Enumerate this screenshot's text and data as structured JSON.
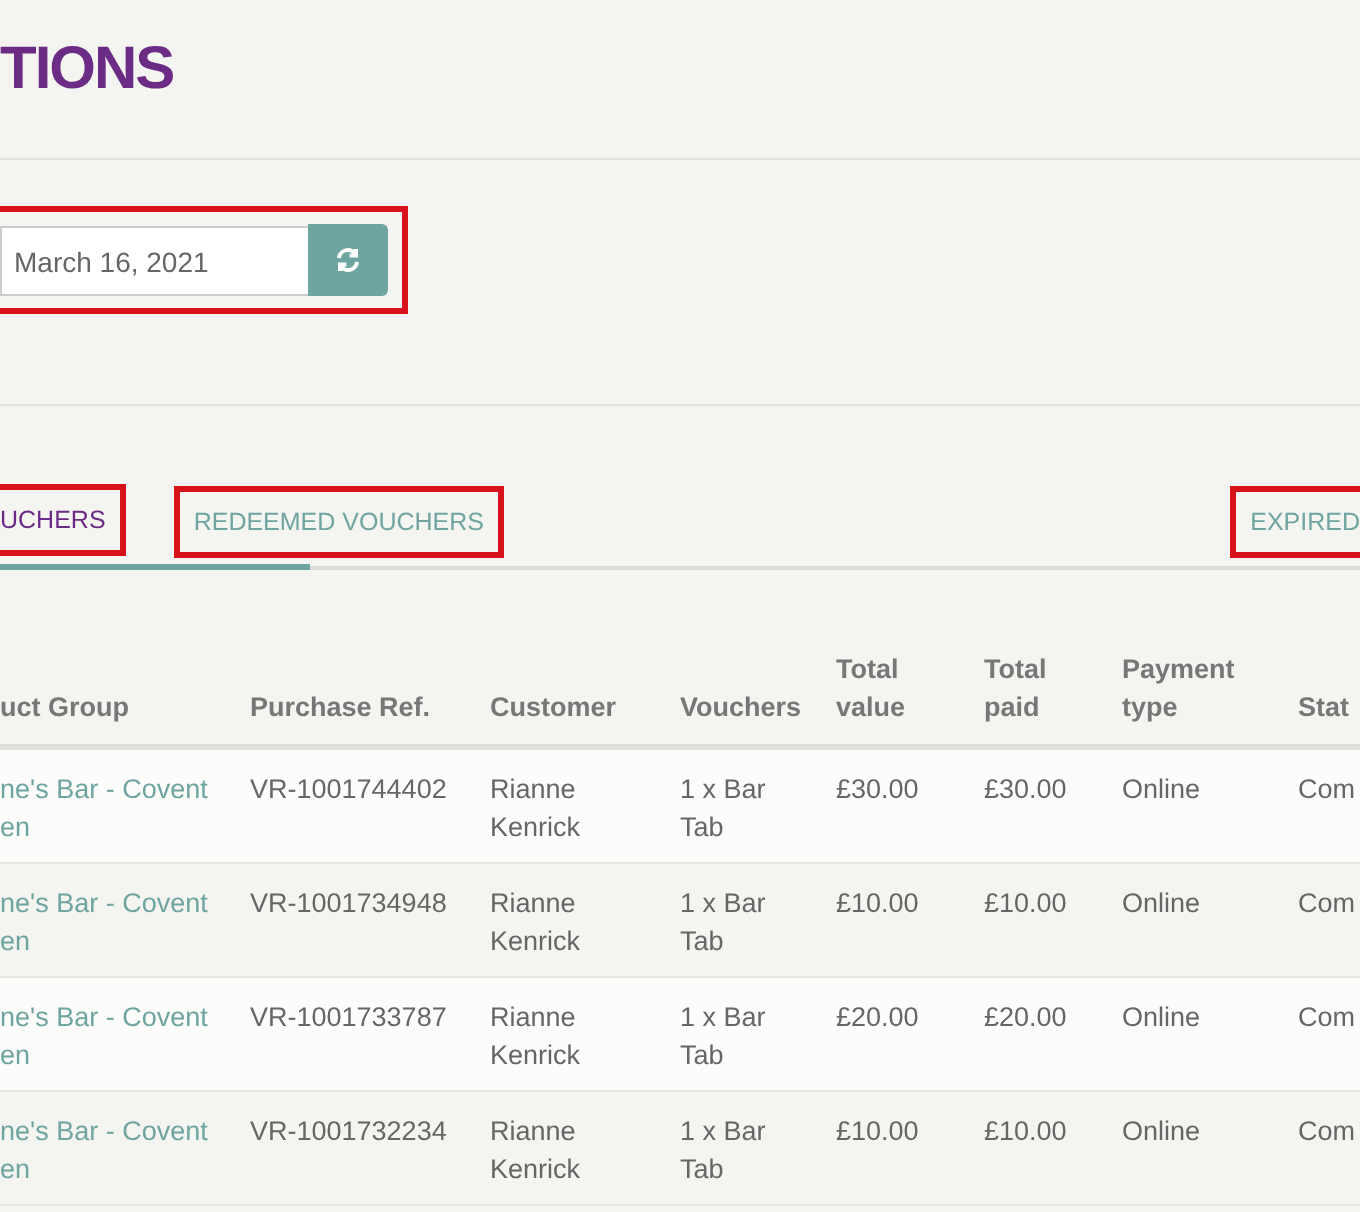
{
  "page_title": "TIONS",
  "date_filter": {
    "value": "March 16, 2021",
    "highlighted": true
  },
  "tabs": [
    {
      "label": "UCHERS",
      "selected": true,
      "highlighted": true
    },
    {
      "label": "REDEEMED VOUCHERS",
      "selected": false,
      "highlighted": true
    },
    {
      "label": "EXPIRED",
      "selected": false,
      "highlighted": true
    }
  ],
  "table": {
    "columns": [
      "uct Group",
      "Purchase Ref.",
      "Customer",
      "Vouchers",
      "Total\nvalue",
      "Total\npaid",
      "Payment\ntype",
      "Stat"
    ],
    "rows": [
      [
        "ne's Bar - Covent\nen",
        "VR-1001744402",
        "Rianne\nKenrick",
        "1 x Bar\nTab",
        "£30.00",
        "£30.00",
        "Online",
        "Com"
      ],
      [
        "ne's Bar - Covent\nen",
        "VR-1001734948",
        "Rianne\nKenrick",
        "1 x Bar\nTab",
        "£10.00",
        "£10.00",
        "Online",
        "Com"
      ],
      [
        "ne's Bar - Covent\nen",
        "VR-1001733787",
        "Rianne\nKenrick",
        "1 x Bar\nTab",
        "£20.00",
        "£20.00",
        "Online",
        "Com"
      ],
      [
        "ne's Bar - Covent\nen",
        "VR-1001732234",
        "Rianne\nKenrick",
        "1 x Bar\nTab",
        "£10.00",
        "£10.00",
        "Online",
        "Com"
      ]
    ]
  }
}
